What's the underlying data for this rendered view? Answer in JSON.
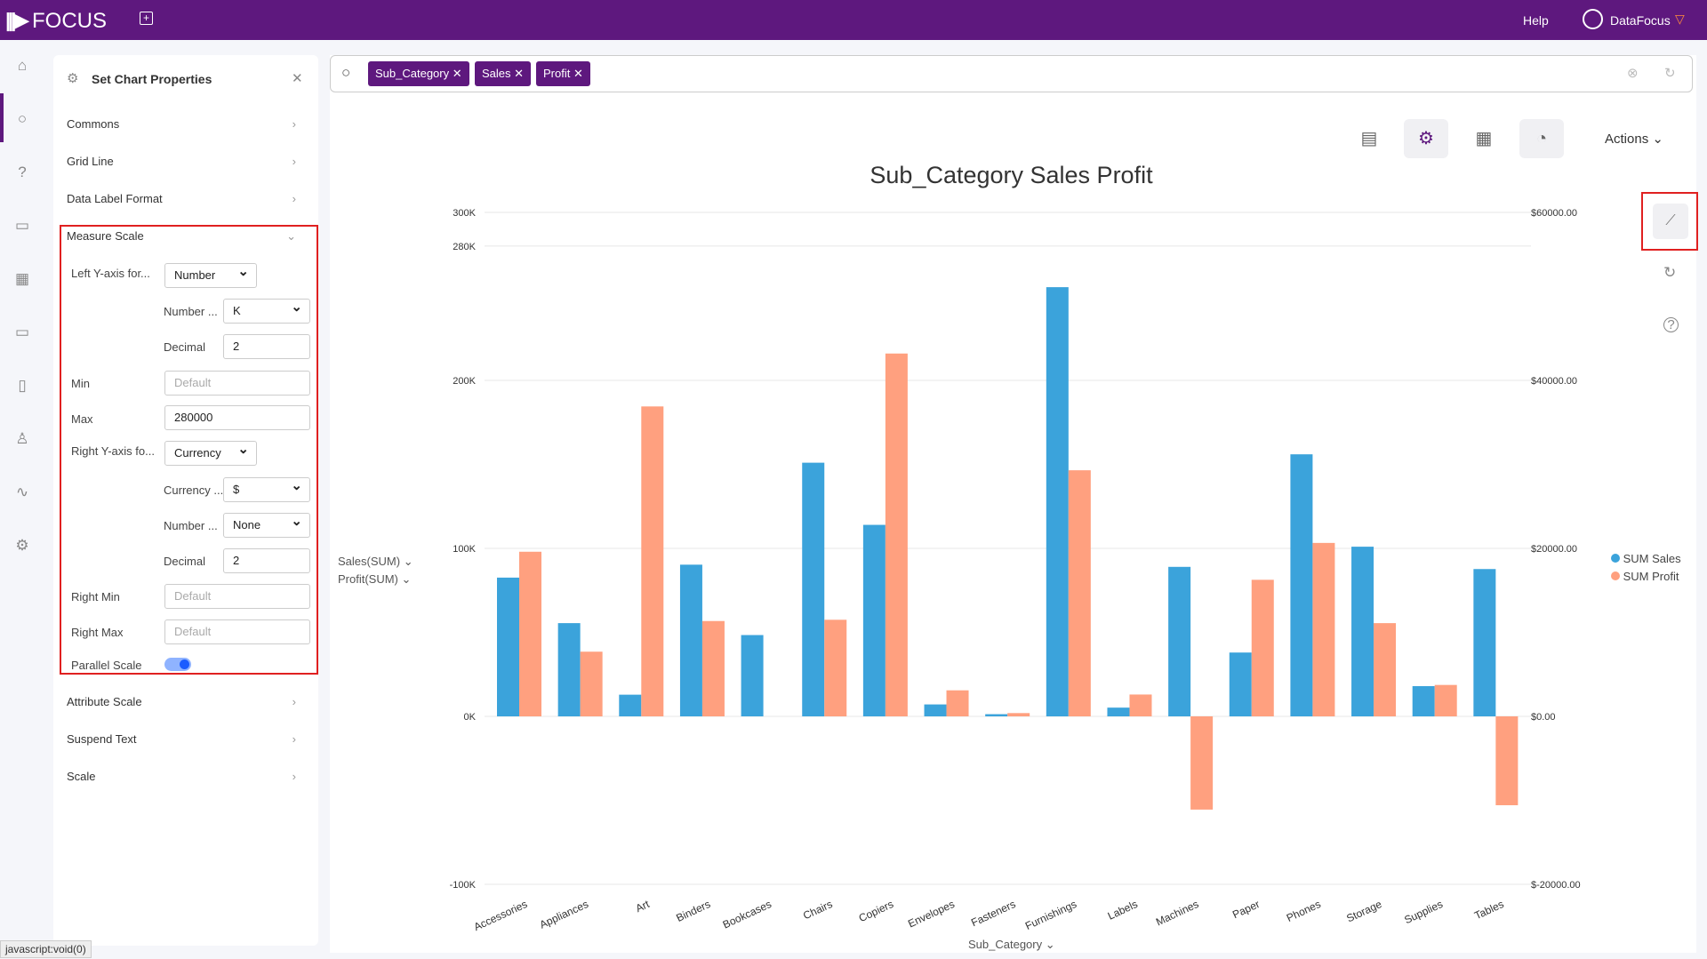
{
  "app": {
    "logo": "FOCUS",
    "help": "Help",
    "user": "DataFocus"
  },
  "panel": {
    "title": "Set Chart Properties",
    "sections": {
      "commons": "Commons",
      "grid_line": "Grid Line",
      "data_label_format": "Data Label Format",
      "measure_scale": "Measure Scale",
      "attribute_scale": "Attribute Scale",
      "suspend_text": "Suspend Text",
      "scale": "Scale"
    },
    "measure": {
      "left_y_label": "Left Y-axis for...",
      "left_y_value": "Number",
      "number_unit_label": "Number ...",
      "number_unit_value": "K",
      "decimal_label": "Decimal",
      "decimal_value": "2",
      "min_label": "Min",
      "min_placeholder": "Default",
      "max_label": "Max",
      "max_value": "280000",
      "right_y_label": "Right Y-axis fo...",
      "right_y_value": "Currency",
      "currency_label": "Currency ...",
      "currency_value": "$",
      "right_number_label": "Number ...",
      "right_number_value": "None",
      "right_decimal_label": "Decimal",
      "right_decimal_value": "2",
      "right_min_label": "Right Min",
      "right_min_placeholder": "Default",
      "right_max_label": "Right Max",
      "right_max_placeholder": "Default",
      "parallel_label": "Parallel Scale",
      "parallel_on": true
    }
  },
  "search": {
    "tags": [
      "Sub_Category",
      "Sales",
      "Profit"
    ]
  },
  "toolbar": {
    "actions": "Actions"
  },
  "axis_pickers": {
    "left1": "Sales(SUM)",
    "left2": "Profit(SUM)",
    "x": "Sub_Category"
  },
  "status": "javascript:void(0)",
  "colors": {
    "brand": "#5e187e",
    "sales": "#3ba3db",
    "profit": "#ffa07f",
    "highlight": "#e02020"
  },
  "chart_data": {
    "type": "bar",
    "title": "Sub_Category Sales Profit",
    "xlabel": "Sub_Category",
    "categories": [
      "Accessories",
      "Appliances",
      "Art",
      "Binders",
      "Bookcases",
      "Chairs",
      "Copiers",
      "Envelopes",
      "Fasteners",
      "Furnishings",
      "Labels",
      "Machines",
      "Paper",
      "Phones",
      "Storage",
      "Supplies",
      "Tables"
    ],
    "series": [
      {
        "name": "SUM Sales",
        "axis": "left",
        "values": [
          82600,
          55500,
          12900,
          90300,
          48400,
          151000,
          114000,
          7100,
          1300,
          255500,
          5200,
          89000,
          38000,
          156000,
          101000,
          18000,
          87700
        ]
      },
      {
        "name": "SUM Profit",
        "axis": "right",
        "values": [
          19600,
          7700,
          36900,
          11350,
          0,
          11500,
          43200,
          3100,
          390,
          29300,
          2600,
          -11100,
          16260,
          20650,
          11100,
          3740,
          -10580
        ]
      }
    ],
    "left_ticks": [
      "300K",
      "280K",
      "200K",
      "100K",
      "0K",
      "-100K"
    ],
    "right_ticks": [
      "$60000.00",
      "$40000.00",
      "$20000.00",
      "$0.00",
      "$-20000.00"
    ],
    "ylim_left": [
      -100000,
      300000
    ],
    "ylim_right": [
      -20000,
      60000
    ],
    "grid": true,
    "legend": "right"
  }
}
